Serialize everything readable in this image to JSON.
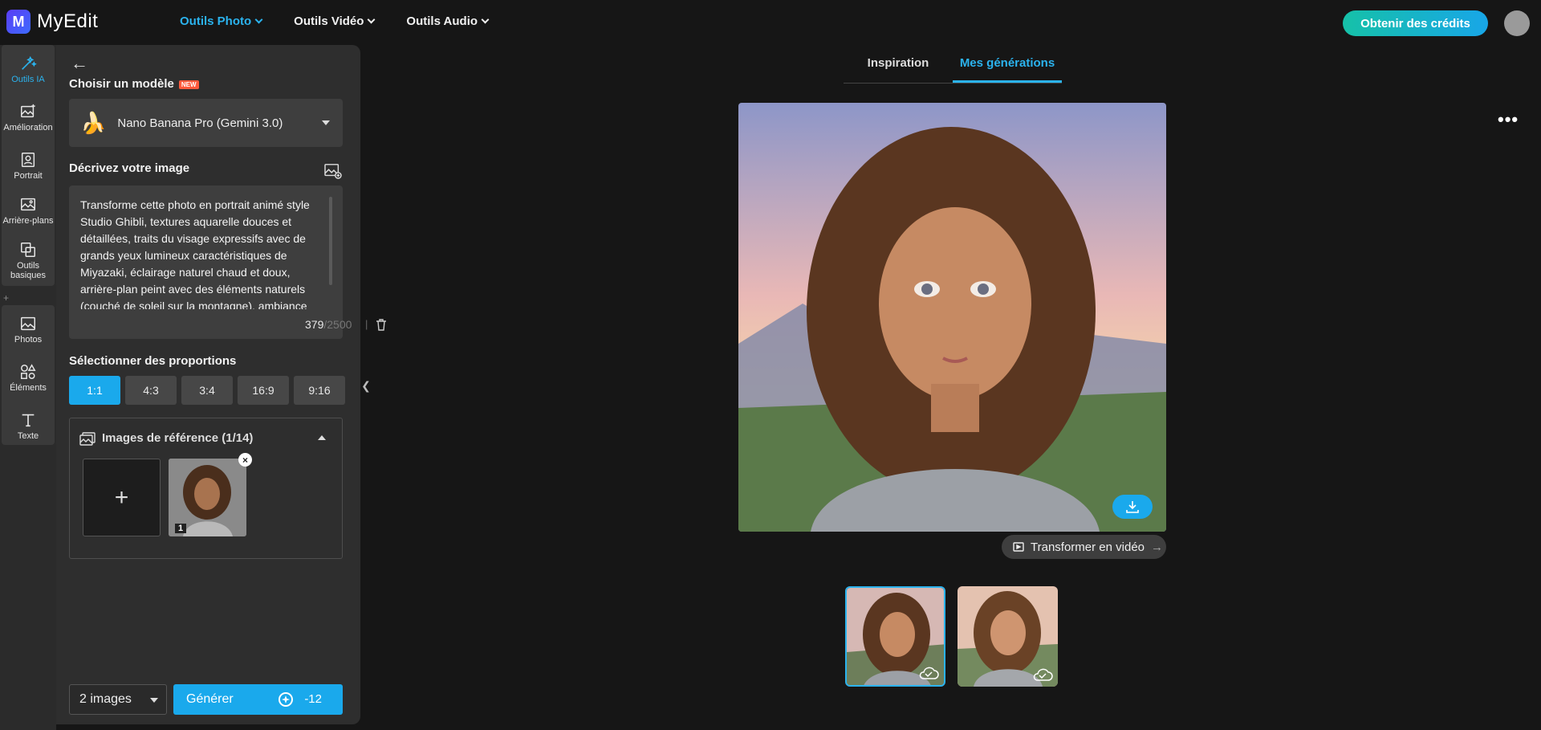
{
  "app": {
    "logo_letter": "M",
    "name": "MyEdit"
  },
  "nav": [
    {
      "label": "Outils Photo",
      "active": true
    },
    {
      "label": "Outils Vidéo",
      "active": false
    },
    {
      "label": "Outils Audio",
      "active": false
    }
  ],
  "header": {
    "credits_button": "Obtenir des crédits"
  },
  "rail": {
    "items": [
      {
        "label": "Outils IA",
        "icon": "magic-wand-icon",
        "active": true
      },
      {
        "label": "Amélioration",
        "icon": "enhance-icon"
      },
      {
        "label": "Portrait",
        "icon": "portrait-icon"
      },
      {
        "label": "Arrière-plans",
        "icon": "background-icon"
      },
      {
        "label": "Outils basiques",
        "icon": "basic-tools-icon"
      },
      {
        "label": "Photos",
        "icon": "photo-icon"
      },
      {
        "label": "Éléments",
        "icon": "elements-icon"
      },
      {
        "label": "Texte",
        "icon": "text-icon"
      }
    ]
  },
  "panel": {
    "model_title": "Choisir un modèle",
    "new_badge": "NEW",
    "model_selected": "Nano Banana Pro (Gemini 3.0)",
    "describe_title": "Décrivez votre image",
    "prompt": "Transforme cette photo en portrait animé style Studio Ghibli, textures aquarelle douces et détaillées, traits du visage expressifs avec de grands yeux lumineux caractéristiques de Miyazaki, éclairage naturel chaud et doux, arrière-plan peint avec des éléments naturels (couché de soleil sur la montagne), ambiance",
    "char_count": "379",
    "char_max": "/2500",
    "ratio_title": "Sélectionner des proportions",
    "ratios": [
      {
        "label": "1:1",
        "active": true
      },
      {
        "label": "4:3"
      },
      {
        "label": "3:4"
      },
      {
        "label": "16:9"
      },
      {
        "label": "9:16"
      }
    ],
    "ref_title": "Images de référence (1/14)",
    "ref_add": "+",
    "ref_number": "1",
    "image_count": "2 images",
    "generate_label": "Générer",
    "generate_cost": "-12"
  },
  "main": {
    "tabs": [
      {
        "label": "Inspiration",
        "active": false
      },
      {
        "label": "Mes générations",
        "active": true
      }
    ],
    "more": "•••",
    "to_video": "Transformer en vidéo"
  },
  "colors": {
    "accent": "#1aa9ec",
    "credits_start": "#16c1a8",
    "credits_end": "#18a6e8"
  }
}
